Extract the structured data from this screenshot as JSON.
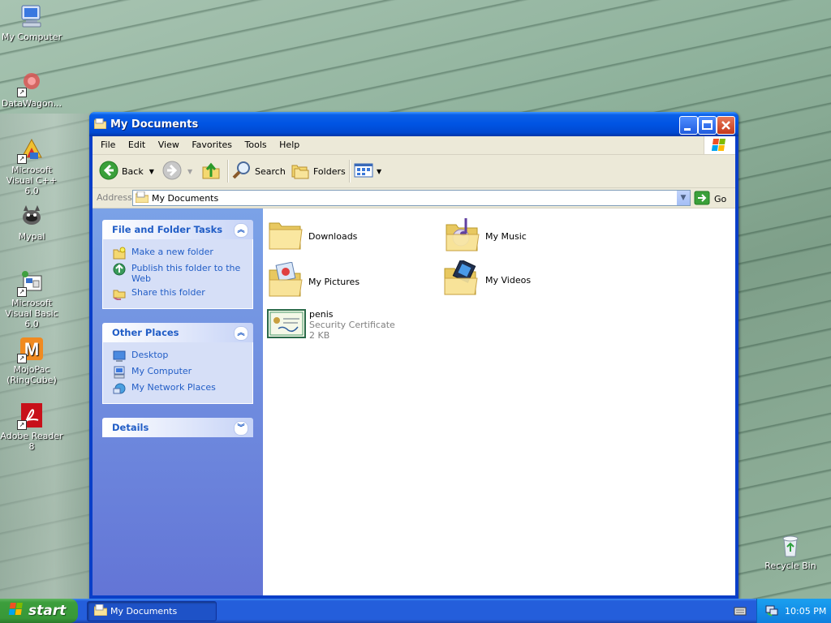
{
  "desktop": {
    "icons": [
      {
        "label": "My Computer",
        "icon": "my-computer-icon"
      },
      {
        "label": "DataWagon...",
        "icon": "datawagon-icon"
      },
      {
        "label": "Microsoft Visual C++ 6.0",
        "icon": "visual-cpp-icon"
      },
      {
        "label": "Mypal",
        "icon": "mypal-icon"
      },
      {
        "label": "Microsoft Visual Basic 6.0",
        "icon": "visual-basic-icon"
      },
      {
        "label": "MojoPac (RingCube)",
        "icon": "mojopac-icon"
      },
      {
        "label": "Adobe Reader 8",
        "icon": "adobe-reader-icon"
      },
      {
        "label": "Recycle Bin",
        "icon": "recycle-bin-icon"
      }
    ]
  },
  "window": {
    "title": "My Documents",
    "menu": [
      "File",
      "Edit",
      "View",
      "Favorites",
      "Tools",
      "Help"
    ],
    "toolbar": {
      "back": "Back",
      "search": "Search",
      "folders": "Folders"
    },
    "address": {
      "label": "Address",
      "value": "My Documents",
      "go": "Go"
    },
    "taskpane": {
      "file_folder_tasks": {
        "title": "File and Folder Tasks",
        "links": [
          "Make a new folder",
          "Publish this folder to the Web",
          "Share this folder"
        ]
      },
      "other_places": {
        "title": "Other Places",
        "links": [
          "Desktop",
          "My Computer",
          "My Network Places"
        ]
      },
      "details": {
        "title": "Details"
      }
    },
    "files": [
      {
        "name": "Downloads",
        "icon": "folder-icon"
      },
      {
        "name": "My Music",
        "icon": "music-folder-icon"
      },
      {
        "name": "My Pictures",
        "icon": "pictures-folder-icon"
      },
      {
        "name": "My Videos",
        "icon": "videos-folder-icon"
      },
      {
        "name": "penis",
        "type": "Security Certificate",
        "size": "2 KB",
        "icon": "certificate-icon"
      }
    ]
  },
  "taskbar": {
    "start": "start",
    "task": "My Documents",
    "clock": "10:05 PM"
  },
  "colors": {
    "titlebar": "#0054e3",
    "taskpane_link": "#215dc6",
    "start_green": "#3c9e3c",
    "taskbar_blue": "#245edb"
  }
}
